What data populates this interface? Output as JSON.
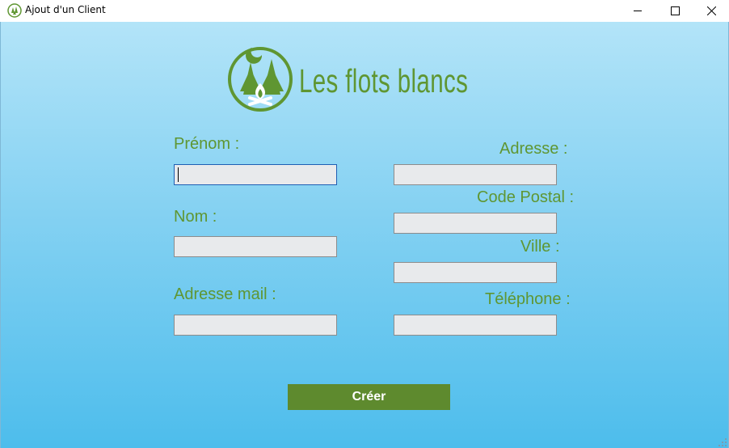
{
  "window": {
    "title": "Ajout d'un Client",
    "icon": "campfire-logo-icon",
    "controls": [
      "minimize-icon",
      "maximize-icon",
      "close-icon"
    ]
  },
  "brand": {
    "name": "Les flots blancs",
    "logo_icon": "campfire-trees-logo",
    "color": "#5f9632"
  },
  "form": {
    "left": [
      {
        "label": "Prénom :",
        "value": ""
      },
      {
        "label": "Nom :",
        "value": ""
      },
      {
        "label": "Adresse mail :",
        "value": ""
      }
    ],
    "right": [
      {
        "label": "Adresse :",
        "value": ""
      },
      {
        "label": "Code Postal :",
        "value": ""
      },
      {
        "label": "Ville :",
        "value": ""
      },
      {
        "label": "Téléphone :",
        "value": ""
      }
    ],
    "submit_label": "Créer",
    "button_color": "#5e8a2e"
  }
}
